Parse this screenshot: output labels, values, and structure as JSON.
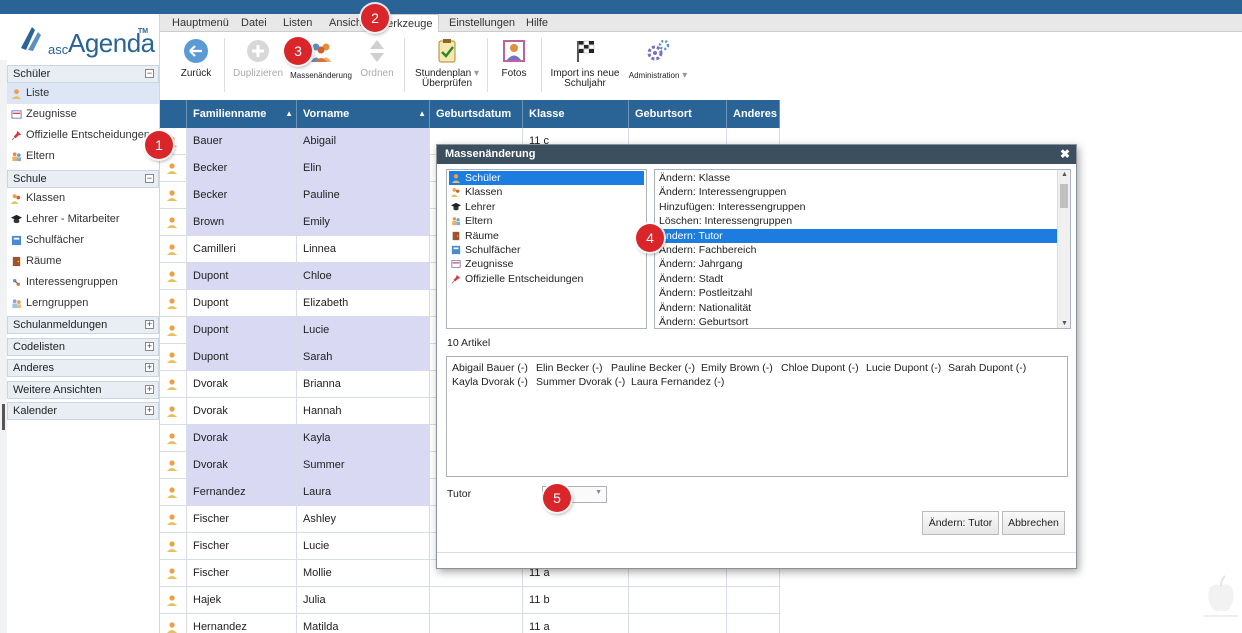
{
  "app": {
    "logo_prefix": "asc",
    "logo_name": "Agenda",
    "logo_tm": "TM"
  },
  "colors": {
    "header_blue": "#2a6496",
    "selection_blue": "#1c7ce0",
    "row_highlight": "#d9d9f3",
    "badge_red": "#d8262a"
  },
  "menu": [
    "Hauptmenü",
    "Datei",
    "Listen",
    "Ansicht",
    "Werkzeuge",
    "Einstellungen",
    "Hilfe"
  ],
  "active_menu": "Werkzeuge",
  "toolbar": {
    "back": "Zurück",
    "duplicate": "Duplizieren",
    "mass_change": "Massenänderung",
    "order": "Ordnen",
    "timetable_line1": "Stundenplan",
    "timetable_line2": "Überprüfen",
    "photos": "Fotos",
    "import_line1": "Import ins neue",
    "import_line2": "Schuljahr",
    "admin": "Administration"
  },
  "sidebar": {
    "students_header": "Schüler",
    "students_items": [
      "Liste",
      "Zeugnisse",
      "Offizielle Entscheidungen",
      "Eltern"
    ],
    "school_header": "Schule",
    "school_items": [
      "Klassen",
      "Lehrer - Mitarbeiter",
      "Schulfächer",
      "Räume",
      "Interessengruppen",
      "Lerngruppen"
    ],
    "collapsed_sections": [
      "Schulanmeldungen",
      "Codelisten",
      "Anderes",
      "Weitere Ansichten",
      "Kalender"
    ]
  },
  "grid": {
    "headers": [
      "Familienname",
      "Vorname",
      "Geburtsdatum",
      "Klasse",
      "Geburtsort",
      "Anderes -"
    ],
    "rows": [
      {
        "last": "Bauer",
        "first": "Abigail",
        "class": "11 c",
        "selected": true
      },
      {
        "last": "Becker",
        "first": "Elin",
        "class": "",
        "selected": true
      },
      {
        "last": "Becker",
        "first": "Pauline",
        "class": "",
        "selected": true
      },
      {
        "last": "Brown",
        "first": "Emily",
        "class": "",
        "selected": true
      },
      {
        "last": "Camilleri",
        "first": "Linnea",
        "class": "",
        "selected": false
      },
      {
        "last": "Dupont",
        "first": "Chloe",
        "class": "",
        "selected": true
      },
      {
        "last": "Dupont",
        "first": "Elizabeth",
        "class": "",
        "selected": false
      },
      {
        "last": "Dupont",
        "first": "Lucie",
        "class": "",
        "selected": true
      },
      {
        "last": "Dupont",
        "first": "Sarah",
        "class": "",
        "selected": true
      },
      {
        "last": "Dvorak",
        "first": "Brianna",
        "class": "",
        "selected": false
      },
      {
        "last": "Dvorak",
        "first": "Hannah",
        "class": "",
        "selected": false
      },
      {
        "last": "Dvorak",
        "first": "Kayla",
        "class": "",
        "selected": true
      },
      {
        "last": "Dvorak",
        "first": "Summer",
        "class": "",
        "selected": true
      },
      {
        "last": "Fernandez",
        "first": "Laura",
        "class": "",
        "selected": true
      },
      {
        "last": "Fischer",
        "first": "Ashley",
        "class": "",
        "selected": false
      },
      {
        "last": "Fischer",
        "first": "Lucie",
        "class": "",
        "selected": false
      },
      {
        "last": "Fischer",
        "first": "Mollie",
        "class": "11 a",
        "selected": false
      },
      {
        "last": "Hajek",
        "first": "Julia",
        "class": "11 b",
        "selected": false
      },
      {
        "last": "Hernandez",
        "first": "Matilda",
        "class": "11 a",
        "selected": false
      }
    ]
  },
  "dialog": {
    "title": "Massenänderung",
    "close": "✖",
    "entity_list": [
      "Schüler",
      "Klassen",
      "Lehrer",
      "Eltern",
      "Räume",
      "Schulfächer",
      "Zeugnisse",
      "Offizielle Entscheidungen"
    ],
    "selected_entity": "Schüler",
    "actions": [
      "Ändern: Klasse",
      "Ändern: Interessengruppen",
      "Hinzufügen: Interessengruppen",
      "Löschen: Interessengruppen",
      "Ändern: Tutor",
      "Ändern: Fachbereich",
      "Ändern: Jahrgang",
      "Ändern: Stadt",
      "Ändern: Postleitzahl",
      "Ändern: Nationalität",
      "Ändern: Geburtsort"
    ],
    "selected_action": "Ändern: Tutor",
    "count_label": "10 Artikel",
    "selected_items": [
      "Abigail Bauer (-)",
      "Elin Becker (-)",
      "Pauline Becker (-)",
      "Emily Brown (-)",
      "Chloe Dupont (-)",
      "Lucie Dupont (-)",
      "Sarah Dupont (-)",
      "Kayla Dvorak (-)",
      "Summer Dvorak (-)",
      "Laura Fernandez (-)"
    ],
    "field_label": "Tutor",
    "field_value": "",
    "confirm": "Ändern: Tutor",
    "cancel": "Abbrechen"
  },
  "callouts": [
    "1",
    "2",
    "3",
    "4",
    "5"
  ]
}
